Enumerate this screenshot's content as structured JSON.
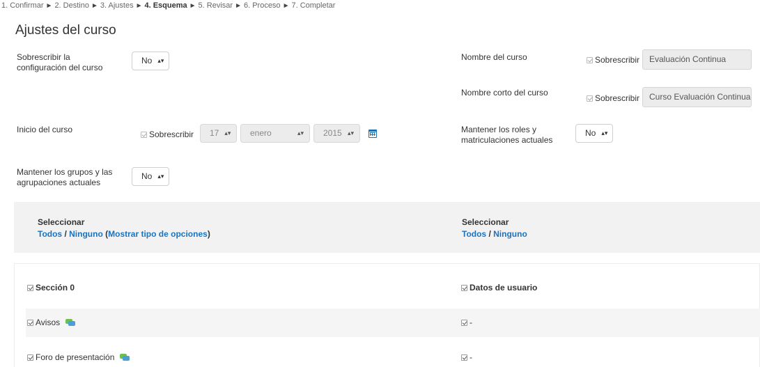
{
  "breadcrumb": {
    "steps": [
      "1. Confirmar",
      "2. Destino",
      "3. Ajustes",
      "4. Esquema",
      "5. Revisar",
      "6. Proceso",
      "7. Completar"
    ],
    "separator": "►",
    "current_index": 3
  },
  "section_title": "Ajustes del curso",
  "settings": {
    "overwrite_conf": {
      "label_line1": "Sobrescribir la",
      "label_line2": "configuración del curso",
      "value": "No"
    },
    "course_name": {
      "label": "Nombre del curso",
      "override": "Sobrescribir",
      "value": "Evaluación Continua"
    },
    "short_name": {
      "label": "Nombre corto del curso",
      "override": "Sobrescribir",
      "value": "Curso Evaluación Continua"
    },
    "start_date": {
      "label": "Inicio del curso",
      "override": "Sobrescribir",
      "day": "17",
      "month": "enero",
      "year": "2015"
    },
    "keep_roles": {
      "label_line1": "Mantener los roles y",
      "label_line2": "matriculaciones actuales",
      "value": "No"
    },
    "keep_groups": {
      "label_line1": "Mantener los grupos y las",
      "label_line2": "agrupaciones actuales",
      "value": "No"
    }
  },
  "select_panel": {
    "left": {
      "heading": "Seleccionar",
      "all": "Todos",
      "slash": " / ",
      "none": "Ninguno",
      "paren_open": " (",
      "show_types": "Mostrar tipo de opciones",
      "paren_close": ")"
    },
    "right": {
      "heading": "Seleccionar",
      "all": "Todos",
      "slash": " / ",
      "none": "Ninguno"
    }
  },
  "items": {
    "section0": "Sección 0",
    "user_data": "Datos de usuario",
    "avisos": "Avisos",
    "avisos_user": "-",
    "foro": "Foro de presentación",
    "foro_user": "-"
  },
  "colors": {
    "link": "#1a73c2",
    "panel_bg": "#f2f2f2",
    "calendar_icon": "#1a6fb5"
  },
  "icons": {
    "select_caret": "up-down-caret",
    "calendar": "calendar-icon",
    "forum": "forum-icon"
  }
}
